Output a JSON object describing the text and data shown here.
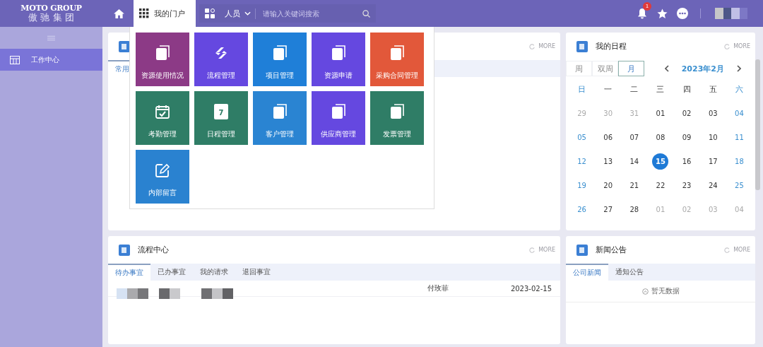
{
  "header": {
    "logo_title": "MOTO GROUP",
    "logo_subtitle": "傲 驰 集 团",
    "portal_tab": {
      "label": "我的门户",
      "selected": true
    },
    "search": {
      "category": "人员",
      "placeholder": "请输入关键词搜索"
    },
    "notification_count": "1"
  },
  "sidebar": {
    "items": [
      {
        "label": "工作中心",
        "selected": true
      }
    ]
  },
  "portal_menu": {
    "tiles": [
      {
        "label": "资源使用情况",
        "kind": "document",
        "color": "#8c3a86"
      },
      {
        "label": "流程管理",
        "kind": "sync",
        "color": "#6548e0"
      },
      {
        "label": "项目管理",
        "kind": "document",
        "color": "#1f7fd8"
      },
      {
        "label": "资源申请",
        "kind": "document",
        "color": "#6548e0"
      },
      {
        "label": "采购合同管理",
        "kind": "document",
        "color": "#e2583a"
      },
      {
        "label": "考勤管理",
        "kind": "calendar-check",
        "color": "#2f7d66"
      },
      {
        "label": "日程管理",
        "kind": "calendar-day",
        "icon_text": "7",
        "color": "#2f7d66"
      },
      {
        "label": "客户管理",
        "kind": "document",
        "color": "#2a84d2"
      },
      {
        "label": "供应商管理",
        "kind": "document",
        "color": "#6548e0"
      },
      {
        "label": "发票管理",
        "kind": "document",
        "color": "#2f7d66"
      },
      {
        "label": "内部留言",
        "kind": "edit",
        "color": "#2a82d0"
      }
    ]
  },
  "common_card": {
    "tab": {
      "label": "常用",
      "selected": true
    },
    "more": "MORE"
  },
  "schedule": {
    "title": "我的日程",
    "more": "MORE",
    "views": [
      {
        "label": "周",
        "selected": false
      },
      {
        "label": "双周",
        "selected": false
      },
      {
        "label": "月",
        "selected": true
      }
    ],
    "month": "2023年2月",
    "weekdays": [
      {
        "label": "日",
        "weekend": true
      },
      {
        "label": "一",
        "weekend": false
      },
      {
        "label": "二",
        "weekend": false
      },
      {
        "label": "三",
        "weekend": false
      },
      {
        "label": "四",
        "weekend": false
      },
      {
        "label": "五",
        "weekend": false
      },
      {
        "label": "六",
        "weekend": true
      }
    ],
    "days": [
      {
        "label": "29",
        "muted": true,
        "selected": false
      },
      {
        "label": "30",
        "muted": true,
        "selected": false
      },
      {
        "label": "31",
        "muted": true,
        "selected": false
      },
      {
        "label": "01",
        "muted": false,
        "weekend": false,
        "selected": false
      },
      {
        "label": "02",
        "muted": false,
        "weekend": false,
        "selected": false
      },
      {
        "label": "03",
        "muted": false,
        "weekend": false,
        "selected": false
      },
      {
        "label": "04",
        "muted": false,
        "weekend": true,
        "selected": false
      },
      {
        "label": "05",
        "muted": false,
        "weekend": true,
        "selected": false
      },
      {
        "label": "06",
        "muted": false,
        "weekend": false,
        "selected": false
      },
      {
        "label": "07",
        "muted": false,
        "weekend": false,
        "selected": false
      },
      {
        "label": "08",
        "muted": false,
        "weekend": false,
        "selected": false
      },
      {
        "label": "09",
        "muted": false,
        "weekend": false,
        "selected": false
      },
      {
        "label": "10",
        "muted": false,
        "weekend": false,
        "selected": false
      },
      {
        "label": "11",
        "muted": false,
        "weekend": true,
        "selected": false
      },
      {
        "label": "12",
        "muted": false,
        "weekend": true,
        "selected": false
      },
      {
        "label": "13",
        "muted": false,
        "weekend": false,
        "selected": false
      },
      {
        "label": "14",
        "muted": false,
        "weekend": false,
        "selected": false
      },
      {
        "label": "15",
        "muted": false,
        "weekend": false,
        "selected": true
      },
      {
        "label": "16",
        "muted": false,
        "weekend": false,
        "selected": false
      },
      {
        "label": "17",
        "muted": false,
        "weekend": false,
        "selected": false
      },
      {
        "label": "18",
        "muted": false,
        "weekend": true,
        "selected": false
      },
      {
        "label": "19",
        "muted": false,
        "weekend": true,
        "selected": false
      },
      {
        "label": "20",
        "muted": false,
        "weekend": false,
        "selected": false
      },
      {
        "label": "21",
        "muted": false,
        "weekend": false,
        "selected": false
      },
      {
        "label": "22",
        "muted": false,
        "weekend": false,
        "selected": false
      },
      {
        "label": "23",
        "muted": false,
        "weekend": false,
        "selected": false
      },
      {
        "label": "24",
        "muted": false,
        "weekend": false,
        "selected": false
      },
      {
        "label": "25",
        "muted": false,
        "weekend": true,
        "selected": false
      },
      {
        "label": "26",
        "muted": false,
        "weekend": true,
        "selected": false
      },
      {
        "label": "27",
        "muted": false,
        "weekend": false,
        "selected": false
      },
      {
        "label": "28",
        "muted": false,
        "weekend": false,
        "selected": false
      },
      {
        "label": "01",
        "muted": true,
        "selected": false
      },
      {
        "label": "02",
        "muted": true,
        "selected": false
      },
      {
        "label": "03",
        "muted": true,
        "selected": false
      },
      {
        "label": "04",
        "muted": true,
        "selected": false
      }
    ]
  },
  "workflow": {
    "title": "流程中心",
    "more": "MORE",
    "tabs": [
      {
        "label": "待办事宜",
        "selected": true
      },
      {
        "label": "已办事宜",
        "selected": false
      },
      {
        "label": "我的请求",
        "selected": false
      },
      {
        "label": "退回事宜",
        "selected": false
      }
    ],
    "rows": [
      {
        "person": "付玫菲",
        "date": "2023-02-15"
      }
    ]
  },
  "news": {
    "title": "新闻公告",
    "more": "MORE",
    "tabs": [
      {
        "label": "公司新闻",
        "selected": true
      },
      {
        "label": "通知公告",
        "selected": false
      }
    ],
    "empty": "暂无数据"
  }
}
